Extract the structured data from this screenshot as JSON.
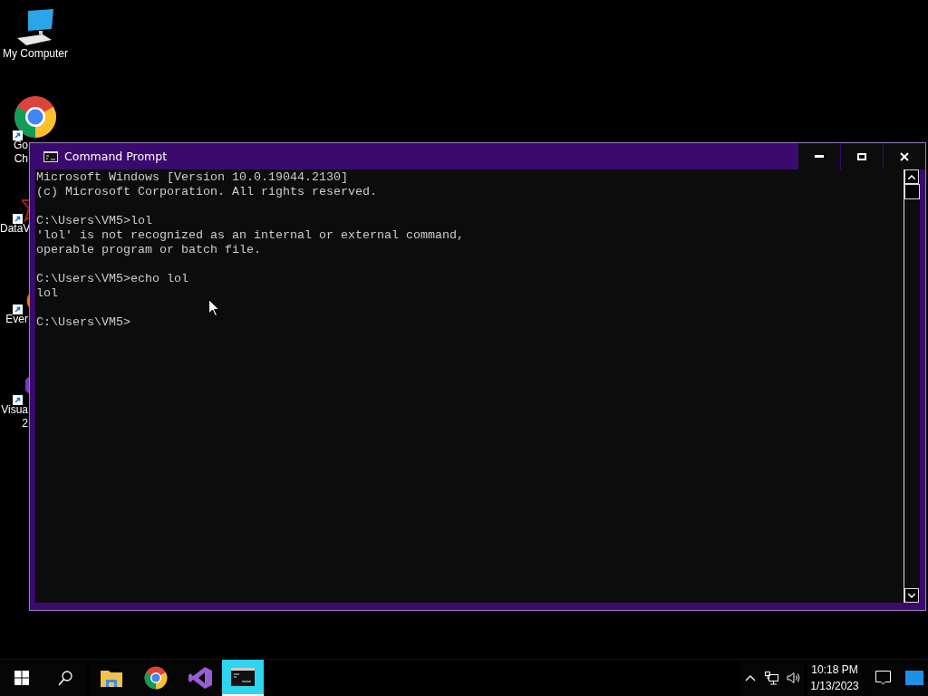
{
  "desktop_icons": [
    {
      "kind": "computer",
      "label_lines": [
        "My Computer"
      ],
      "cut": false
    },
    {
      "kind": "chrome",
      "label_lines": [
        "Go",
        "Ch"
      ],
      "cut": true
    },
    {
      "kind": "star",
      "label_lines": [
        "DataV"
      ],
      "cut": true
    },
    {
      "kind": "flame",
      "label_lines": [
        "Ever"
      ],
      "cut": true
    },
    {
      "kind": "studio",
      "label_lines": [
        "Visua",
        "2"
      ],
      "cut": true
    }
  ],
  "window": {
    "title": "Command Prompt",
    "active": true,
    "console_blocks": [
      [
        "Microsoft Windows [Version 10.0.19044.2130]",
        "(c) Microsoft Corporation. All rights reserved."
      ],
      [
        "C:\\Users\\VM5>lol",
        "'lol' is not recognized as an internal or external command,",
        "operable program or batch file."
      ],
      [
        "C:\\Users\\VM5>echo lol",
        "lol"
      ],
      [
        "C:\\Users\\VM5>"
      ]
    ]
  },
  "taskbar": {
    "apps": [
      {
        "kind": "folder",
        "selected": false
      },
      {
        "kind": "chrome",
        "selected": false
      },
      {
        "kind": "studio",
        "selected": false
      },
      {
        "kind": "console",
        "selected": true
      }
    ],
    "clock": {
      "time": "10:18 PM",
      "date": "1/13/2023"
    }
  }
}
